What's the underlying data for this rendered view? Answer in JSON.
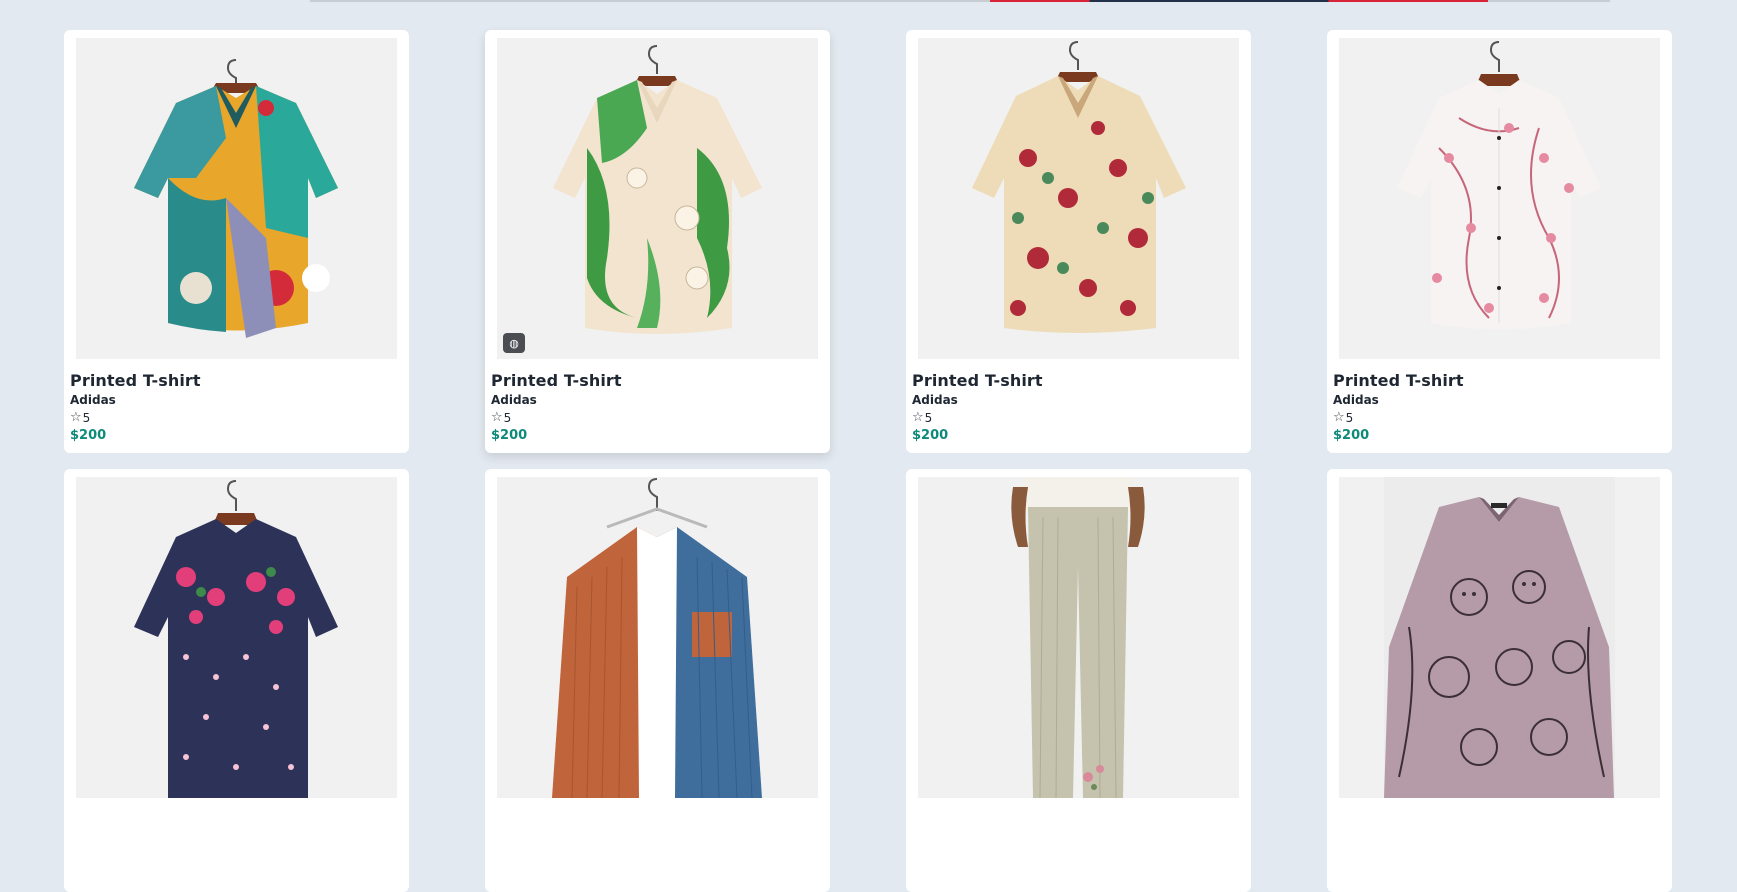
{
  "products": [
    {
      "title": "Printed T-shirt",
      "brand": "Adidas",
      "rating": "5",
      "price": "$200",
      "image": "colorful-abstract-shirt",
      "star_icon": "star-outline-icon"
    },
    {
      "title": "Printed T-shirt",
      "brand": "Adidas",
      "rating": "5",
      "price": "$200",
      "image": "green-lily-shirt",
      "star_icon": "star-outline-icon",
      "badge": "quick-view-icon"
    },
    {
      "title": "Printed T-shirt",
      "brand": "Adidas",
      "rating": "5",
      "price": "$200",
      "image": "cream-rose-shirt",
      "star_icon": "star-outline-icon"
    },
    {
      "title": "Printed T-shirt",
      "brand": "Adidas",
      "rating": "5",
      "price": "$200",
      "image": "white-blossom-shirt",
      "star_icon": "star-outline-icon"
    },
    {
      "image": "navy-floral-shirt"
    },
    {
      "image": "corduroy-colorblock-shirt"
    },
    {
      "image": "linen-pants"
    },
    {
      "image": "cat-print-blouse"
    }
  ],
  "colors": {
    "background": "#e3e9f0",
    "card": "#ffffff",
    "price": "#0e8a7a",
    "text": "#1f2733"
  }
}
